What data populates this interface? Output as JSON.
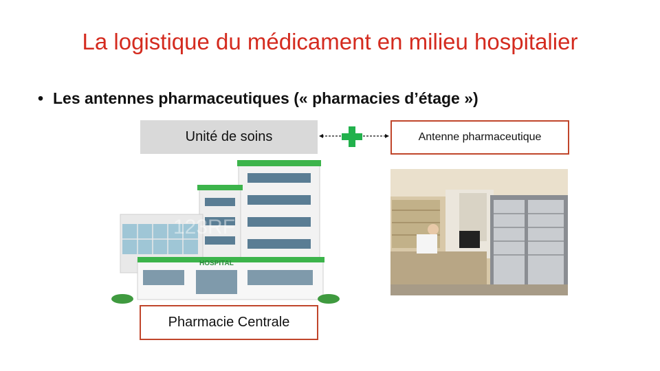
{
  "slide": {
    "title": "La logistique du médicament en milieu hospitalier",
    "bullet": "Les antennes pharmaceutiques (« pharmacies d’étage »)",
    "unit_label": "Unité de soins",
    "antenne_label": "Antenne pharmaceutique",
    "centrale_label": "Pharmacie Centrale",
    "hospital_sign": "HOSPITAL",
    "watermark": "123RF"
  },
  "colors": {
    "title": "#d42b1f",
    "box_border": "#c0452a",
    "gray_box": "#d9d9d9",
    "cross": "#22b14c"
  },
  "icons": {
    "bullet": "bullet-dot",
    "connector": "green-plus-cross",
    "left_arrow": "arrow-left",
    "right_arrow": "arrow-right"
  }
}
